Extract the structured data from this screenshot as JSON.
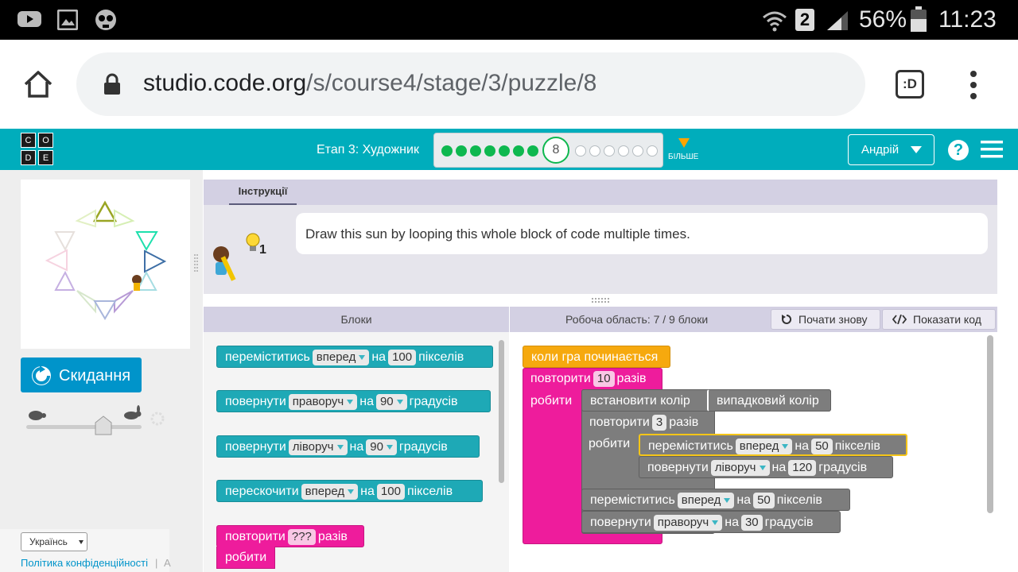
{
  "status_bar": {
    "battery": "56%",
    "time": "11:23",
    "sim": "2"
  },
  "browser": {
    "url_host": "studio.code.org",
    "url_path": "/s/course4/stage/3/puzzle/8",
    "tab_badge": ":D"
  },
  "header": {
    "logo_letters": [
      "C",
      "O",
      "D",
      "E"
    ],
    "stage_title": "Етап 3: Художник",
    "current_puzzle": "8",
    "more_label": "БІЛЬШЕ",
    "user_name": "Андрій",
    "help_symbol": "?"
  },
  "progress": {
    "completed": 7,
    "remaining": 6,
    "current": 8
  },
  "left_panel": {
    "reset_label": "Скидання",
    "language": "Українсь",
    "privacy_link": "Політика конфіденційності",
    "separator": "|",
    "partial_link": "А"
  },
  "instructions": {
    "tab_label": "Інструкції",
    "text": "Draw this sun by looping this whole block of code multiple times.",
    "hint_count": "1"
  },
  "blocks_panel": {
    "title": "Блоки"
  },
  "workspace_panel": {
    "title": "Робоча область: 7 / 9 блоки",
    "restart_label": "Почати знову",
    "show_code_label": "Показати код"
  },
  "toolbox_blocks": [
    {
      "t1": "переміститись",
      "f1": "вперед",
      "t2": "на",
      "f2": "100",
      "t3": "пікселів"
    },
    {
      "t1": "повернути",
      "f1": "праворуч",
      "t2": "на",
      "f2": "90",
      "t3": "градусів"
    },
    {
      "t1": "повернути",
      "f1": "ліворуч",
      "t2": "на",
      "f2": "90",
      "t3": "градусів"
    },
    {
      "t1": "перескочити",
      "f1": "вперед",
      "t2": "на",
      "f2": "100",
      "t3": "пікселів"
    },
    {
      "t1": "повторити",
      "f1": "???",
      "t2": "разів",
      "t3": "робити"
    }
  ],
  "program": {
    "when_run": "коли гра починається",
    "repeat_outer": {
      "t1": "повторити",
      "count": "10",
      "t2": "разів",
      "do": "робити"
    },
    "set_color": {
      "t1": "встановити колір",
      "value": "випадковий колір"
    },
    "repeat_inner": {
      "t1": "повторити",
      "count": "3",
      "t2": "разів",
      "do": "робити"
    },
    "move_inner": {
      "t1": "переміститись",
      "dir": "вперед",
      "t2": "на",
      "val": "50",
      "t3": "пікселів"
    },
    "turn_inner": {
      "t1": "повернути",
      "dir": "ліворуч",
      "t2": "на",
      "val": "120",
      "t3": "градусів"
    },
    "move_outer": {
      "t1": "переміститись",
      "dir": "вперед",
      "t2": "на",
      "val": "50",
      "t3": "пікселів"
    },
    "turn_outer": {
      "t1": "повернути",
      "dir": "праворуч",
      "t2": "на",
      "val": "30",
      "t3": "градусів"
    }
  }
}
